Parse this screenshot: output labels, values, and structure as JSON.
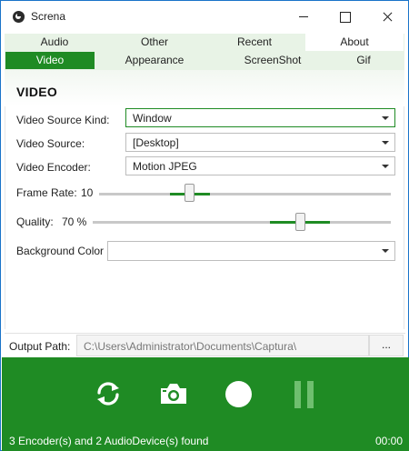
{
  "window": {
    "title": "Screna"
  },
  "tabs": {
    "row1": [
      {
        "label": "Audio"
      },
      {
        "label": "Other"
      },
      {
        "label": "Recent"
      },
      {
        "label": "About"
      }
    ],
    "row2": [
      {
        "label": "Video"
      },
      {
        "label": "Appearance"
      },
      {
        "label": "ScreenShot"
      },
      {
        "label": "Gif"
      }
    ],
    "selected": "Video"
  },
  "video": {
    "heading": "VIDEO",
    "source_kind": {
      "label": "Video Source Kind:",
      "value": "Window"
    },
    "source": {
      "label": "Video Source:",
      "value": "[Desktop]"
    },
    "encoder": {
      "label": "Video Encoder:",
      "value": "Motion JPEG"
    },
    "frame_rate": {
      "label": "Frame Rate:",
      "value": "10",
      "level": 0.3
    },
    "quality": {
      "label": "Quality:",
      "value": "70 %",
      "level": 0.7
    },
    "background_color": {
      "label": "Background Color",
      "value": ""
    }
  },
  "output": {
    "label": "Output Path:",
    "path": "C:\\Users\\Administrator\\Documents\\Captura\\",
    "browse_label": "..."
  },
  "controls": {
    "icons": [
      "refresh-icon",
      "camera-icon",
      "record-icon",
      "pause-icon"
    ]
  },
  "status": {
    "text": "3 Encoder(s) and 2 AudioDevice(s) found",
    "timer": "00:00"
  },
  "colors": {
    "accent": "#1f8b24",
    "tab_background": "#e8f3e6",
    "pause_disabled": "#6fbf6f"
  }
}
